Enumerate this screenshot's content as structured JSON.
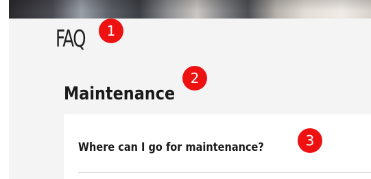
{
  "page": {
    "title": "FAQ"
  },
  "section": {
    "heading": "Maintenance"
  },
  "faq": {
    "items": [
      {
        "question": "Where can I go for maintenance?"
      }
    ]
  },
  "annotations": {
    "markers": [
      "1",
      "2",
      "3"
    ],
    "color": "#ee1111"
  }
}
